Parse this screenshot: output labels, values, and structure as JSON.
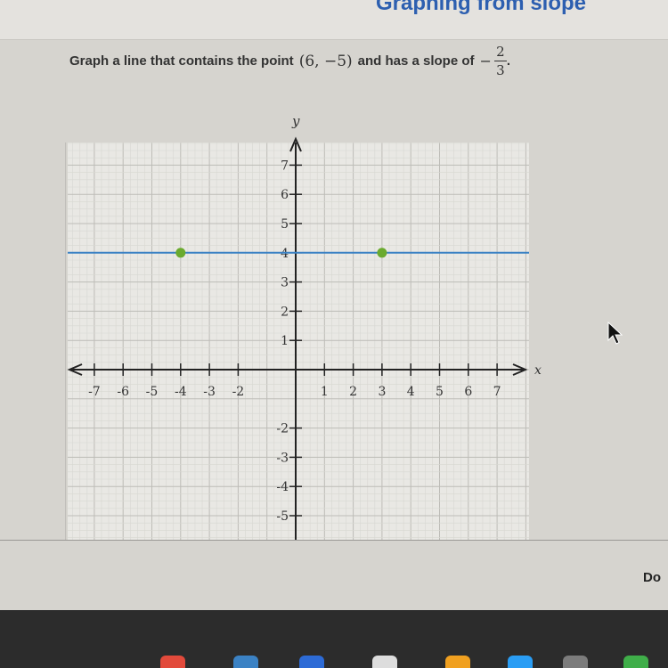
{
  "header": {
    "title": "Graphing from slope"
  },
  "prompt": {
    "text_before": "Graph a line that contains the point",
    "point": "(6, −5)",
    "text_middle": "and has a slope of",
    "slope_sign": "−",
    "slope_numerator": "2",
    "slope_denominator": "3",
    "trailing": "."
  },
  "axes": {
    "x_label": "x",
    "y_label": "y",
    "x_ticks": [
      "-7",
      "-6",
      "-5",
      "-4",
      "-3",
      "-2",
      "1",
      "2",
      "3",
      "4",
      "5",
      "6",
      "7"
    ],
    "y_ticks": [
      "7",
      "6",
      "5",
      "4",
      "3",
      "2",
      "1",
      "-2",
      "-3",
      "-4",
      "-5"
    ]
  },
  "graph": {
    "plotted_points": [
      {
        "x": -4,
        "y": 4
      },
      {
        "x": 3,
        "y": 4
      }
    ],
    "line": {
      "y": 4,
      "color": "#3b82c4"
    },
    "point_color": "#6aaa2e",
    "x_range": [
      -7,
      7
    ],
    "y_range": [
      -5,
      7
    ],
    "grid": true
  },
  "footer": {
    "done_label": "Do"
  },
  "colors": {
    "header_title": "#2d5fb0",
    "line": "#3b82c4",
    "point": "#6aaa2e"
  },
  "icons": {
    "cursor": "arrow-cursor-icon"
  },
  "dock_colors": [
    "#e24a3b",
    "#3b82c4",
    "#2d6bd6",
    "#dddddd",
    "#f0a020",
    "#2a9df4",
    "#7c7c7c",
    "#3fae49"
  ]
}
